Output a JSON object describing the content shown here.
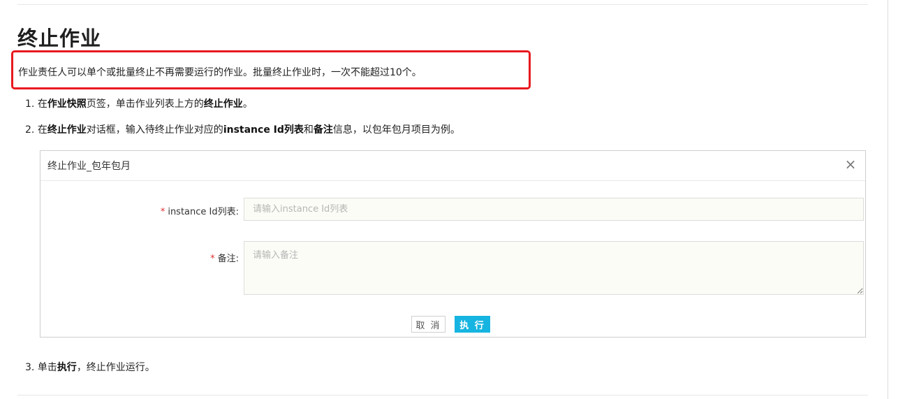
{
  "page": {
    "title": "终止作业",
    "intro": "作业责任人可以单个或批量终止不再需要运行的作业。批量终止作业时，一次不能超过10个。"
  },
  "steps": [
    {
      "num": "1.",
      "parts": [
        {
          "text": "在",
          "bold": false
        },
        {
          "text": "作业快照",
          "bold": true
        },
        {
          "text": "页签，单击作业列表上方的",
          "bold": false
        },
        {
          "text": "终止作业",
          "bold": true
        },
        {
          "text": "。",
          "bold": false
        }
      ]
    },
    {
      "num": "2.",
      "parts": [
        {
          "text": "在",
          "bold": false
        },
        {
          "text": "终止作业",
          "bold": true
        },
        {
          "text": "对话框，输入待终止作业对应的",
          "bold": false
        },
        {
          "text": "instance Id列表",
          "bold": true
        },
        {
          "text": "和",
          "bold": false
        },
        {
          "text": "备注",
          "bold": true
        },
        {
          "text": "信息，以包年包月项目为例。",
          "bold": false
        }
      ]
    },
    {
      "num": "3.",
      "parts": [
        {
          "text": "单击",
          "bold": false
        },
        {
          "text": "执行",
          "bold": true
        },
        {
          "text": "，终止作业运行。",
          "bold": false
        }
      ]
    }
  ],
  "dialog": {
    "title": "终止作业_包年包月",
    "close_icon": "×",
    "required_mark": "*",
    "ids_label": "instance Id列表:",
    "ids_value": "",
    "ids_placeholder": "请输入instance Id列表",
    "note_label": "备注:",
    "note_value": "",
    "note_placeholder": "请输入备注",
    "cancel_label": "取 消",
    "exec_label": "执 行"
  },
  "colors": {
    "highlight_border": "#e8191f",
    "exec_button": "#16b4e0",
    "required_mark": "#e03131"
  }
}
